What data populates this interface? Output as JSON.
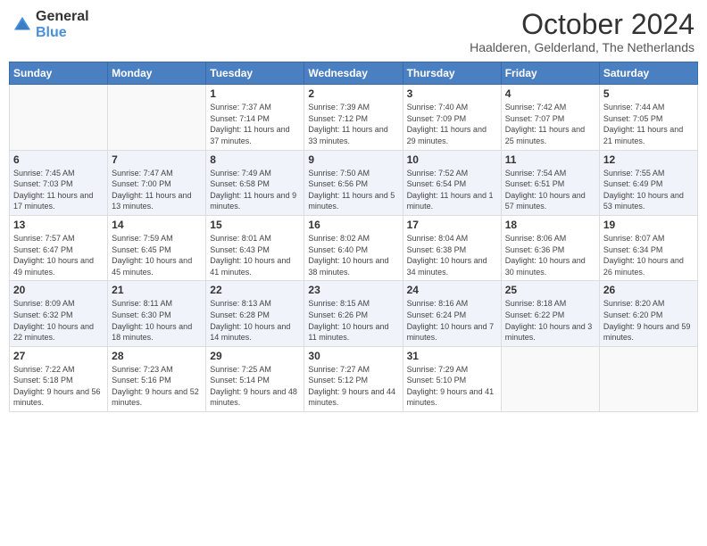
{
  "header": {
    "logo_general": "General",
    "logo_blue": "Blue",
    "month": "October 2024",
    "location": "Haalderen, Gelderland, The Netherlands"
  },
  "days_of_week": [
    "Sunday",
    "Monday",
    "Tuesday",
    "Wednesday",
    "Thursday",
    "Friday",
    "Saturday"
  ],
  "weeks": [
    [
      {
        "day": "",
        "sunrise": "",
        "sunset": "",
        "daylight": ""
      },
      {
        "day": "",
        "sunrise": "",
        "sunset": "",
        "daylight": ""
      },
      {
        "day": "1",
        "sunrise": "Sunrise: 7:37 AM",
        "sunset": "Sunset: 7:14 PM",
        "daylight": "Daylight: 11 hours and 37 minutes."
      },
      {
        "day": "2",
        "sunrise": "Sunrise: 7:39 AM",
        "sunset": "Sunset: 7:12 PM",
        "daylight": "Daylight: 11 hours and 33 minutes."
      },
      {
        "day": "3",
        "sunrise": "Sunrise: 7:40 AM",
        "sunset": "Sunset: 7:09 PM",
        "daylight": "Daylight: 11 hours and 29 minutes."
      },
      {
        "day": "4",
        "sunrise": "Sunrise: 7:42 AM",
        "sunset": "Sunset: 7:07 PM",
        "daylight": "Daylight: 11 hours and 25 minutes."
      },
      {
        "day": "5",
        "sunrise": "Sunrise: 7:44 AM",
        "sunset": "Sunset: 7:05 PM",
        "daylight": "Daylight: 11 hours and 21 minutes."
      }
    ],
    [
      {
        "day": "6",
        "sunrise": "Sunrise: 7:45 AM",
        "sunset": "Sunset: 7:03 PM",
        "daylight": "Daylight: 11 hours and 17 minutes."
      },
      {
        "day": "7",
        "sunrise": "Sunrise: 7:47 AM",
        "sunset": "Sunset: 7:00 PM",
        "daylight": "Daylight: 11 hours and 13 minutes."
      },
      {
        "day": "8",
        "sunrise": "Sunrise: 7:49 AM",
        "sunset": "Sunset: 6:58 PM",
        "daylight": "Daylight: 11 hours and 9 minutes."
      },
      {
        "day": "9",
        "sunrise": "Sunrise: 7:50 AM",
        "sunset": "Sunset: 6:56 PM",
        "daylight": "Daylight: 11 hours and 5 minutes."
      },
      {
        "day": "10",
        "sunrise": "Sunrise: 7:52 AM",
        "sunset": "Sunset: 6:54 PM",
        "daylight": "Daylight: 11 hours and 1 minute."
      },
      {
        "day": "11",
        "sunrise": "Sunrise: 7:54 AM",
        "sunset": "Sunset: 6:51 PM",
        "daylight": "Daylight: 10 hours and 57 minutes."
      },
      {
        "day": "12",
        "sunrise": "Sunrise: 7:55 AM",
        "sunset": "Sunset: 6:49 PM",
        "daylight": "Daylight: 10 hours and 53 minutes."
      }
    ],
    [
      {
        "day": "13",
        "sunrise": "Sunrise: 7:57 AM",
        "sunset": "Sunset: 6:47 PM",
        "daylight": "Daylight: 10 hours and 49 minutes."
      },
      {
        "day": "14",
        "sunrise": "Sunrise: 7:59 AM",
        "sunset": "Sunset: 6:45 PM",
        "daylight": "Daylight: 10 hours and 45 minutes."
      },
      {
        "day": "15",
        "sunrise": "Sunrise: 8:01 AM",
        "sunset": "Sunset: 6:43 PM",
        "daylight": "Daylight: 10 hours and 41 minutes."
      },
      {
        "day": "16",
        "sunrise": "Sunrise: 8:02 AM",
        "sunset": "Sunset: 6:40 PM",
        "daylight": "Daylight: 10 hours and 38 minutes."
      },
      {
        "day": "17",
        "sunrise": "Sunrise: 8:04 AM",
        "sunset": "Sunset: 6:38 PM",
        "daylight": "Daylight: 10 hours and 34 minutes."
      },
      {
        "day": "18",
        "sunrise": "Sunrise: 8:06 AM",
        "sunset": "Sunset: 6:36 PM",
        "daylight": "Daylight: 10 hours and 30 minutes."
      },
      {
        "day": "19",
        "sunrise": "Sunrise: 8:07 AM",
        "sunset": "Sunset: 6:34 PM",
        "daylight": "Daylight: 10 hours and 26 minutes."
      }
    ],
    [
      {
        "day": "20",
        "sunrise": "Sunrise: 8:09 AM",
        "sunset": "Sunset: 6:32 PM",
        "daylight": "Daylight: 10 hours and 22 minutes."
      },
      {
        "day": "21",
        "sunrise": "Sunrise: 8:11 AM",
        "sunset": "Sunset: 6:30 PM",
        "daylight": "Daylight: 10 hours and 18 minutes."
      },
      {
        "day": "22",
        "sunrise": "Sunrise: 8:13 AM",
        "sunset": "Sunset: 6:28 PM",
        "daylight": "Daylight: 10 hours and 14 minutes."
      },
      {
        "day": "23",
        "sunrise": "Sunrise: 8:15 AM",
        "sunset": "Sunset: 6:26 PM",
        "daylight": "Daylight: 10 hours and 11 minutes."
      },
      {
        "day": "24",
        "sunrise": "Sunrise: 8:16 AM",
        "sunset": "Sunset: 6:24 PM",
        "daylight": "Daylight: 10 hours and 7 minutes."
      },
      {
        "day": "25",
        "sunrise": "Sunrise: 8:18 AM",
        "sunset": "Sunset: 6:22 PM",
        "daylight": "Daylight: 10 hours and 3 minutes."
      },
      {
        "day": "26",
        "sunrise": "Sunrise: 8:20 AM",
        "sunset": "Sunset: 6:20 PM",
        "daylight": "Daylight: 9 hours and 59 minutes."
      }
    ],
    [
      {
        "day": "27",
        "sunrise": "Sunrise: 7:22 AM",
        "sunset": "Sunset: 5:18 PM",
        "daylight": "Daylight: 9 hours and 56 minutes."
      },
      {
        "day": "28",
        "sunrise": "Sunrise: 7:23 AM",
        "sunset": "Sunset: 5:16 PM",
        "daylight": "Daylight: 9 hours and 52 minutes."
      },
      {
        "day": "29",
        "sunrise": "Sunrise: 7:25 AM",
        "sunset": "Sunset: 5:14 PM",
        "daylight": "Daylight: 9 hours and 48 minutes."
      },
      {
        "day": "30",
        "sunrise": "Sunrise: 7:27 AM",
        "sunset": "Sunset: 5:12 PM",
        "daylight": "Daylight: 9 hours and 44 minutes."
      },
      {
        "day": "31",
        "sunrise": "Sunrise: 7:29 AM",
        "sunset": "Sunset: 5:10 PM",
        "daylight": "Daylight: 9 hours and 41 minutes."
      },
      {
        "day": "",
        "sunrise": "",
        "sunset": "",
        "daylight": ""
      },
      {
        "day": "",
        "sunrise": "",
        "sunset": "",
        "daylight": ""
      }
    ]
  ]
}
